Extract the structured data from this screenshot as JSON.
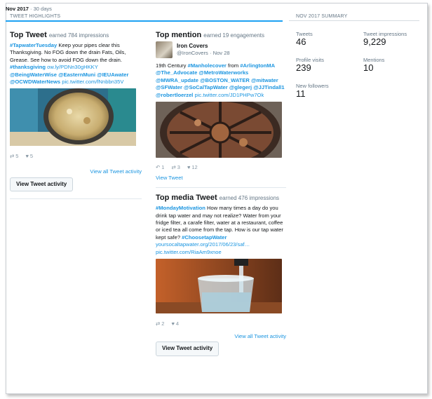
{
  "header": {
    "month": "Nov 2017",
    "sep": "·",
    "days": "30 days"
  },
  "highlights": {
    "title": "TWEET HIGHLIGHTS"
  },
  "top_tweet": {
    "heading": "Top Tweet",
    "metric": "earned 784 impressions",
    "text_parts": [
      {
        "t": "#TapwaterTuesday",
        "k": "hash"
      },
      {
        "t": " Keep your pipes clear this Thanksgiving. No FOG down the drain Fats, Oils, Grease. See how to avoid FOG down the drain. ",
        "k": "plain"
      },
      {
        "t": "#thanksgiving",
        "k": "hash"
      },
      {
        "t": " ow.ly/PDNn30gHKKY ",
        "k": "link"
      },
      {
        "t": "@BeingWaterWise @EasternMuni @IEUAwater @OCWDWaterNews",
        "k": "hash"
      },
      {
        "t": " pic.twitter.com/fNnbbn35V",
        "k": "link"
      }
    ],
    "retweets": "5",
    "likes": "5",
    "view_all": "View all Tweet activity",
    "button": "View Tweet activity"
  },
  "top_mention": {
    "heading": "Top mention",
    "metric": "earned 19 engagements",
    "author_name": "Iron Covers",
    "author_handle": "@IronCovers · Nov 28",
    "text_parts": [
      {
        "t": "19th Century ",
        "k": "plain"
      },
      {
        "t": "#Manholecover",
        "k": "hash"
      },
      {
        "t": " from ",
        "k": "plain"
      },
      {
        "t": "#ArlingtonMA @The_Advocate @MetroWaterworks @MWRA_update @BOSTON_WATER @mitwater @SFWater @SoCalTapWater @glegerj @JJTindall1 @robertloerzel",
        "k": "hash"
      },
      {
        "t": " pic.twitter.com/JD1PHPw7Ok",
        "k": "link"
      }
    ],
    "replies": "1",
    "retweets": "3",
    "likes": "12",
    "view_tweet": "View Tweet"
  },
  "top_media": {
    "heading": "Top media Tweet",
    "metric": "earned 476 impressions",
    "text_parts": [
      {
        "t": "#MondayMotivation",
        "k": "hash"
      },
      {
        "t": " How many times a day do you drink tap water and may not realize? Water from your fridge filter, a carafe filter, water at a restaurant, coffee or iced tea all come from the tap. How is our tap water kept safe? ",
        "k": "plain"
      },
      {
        "t": "#ChoosetapWater",
        "k": "hash"
      },
      {
        "t": " yoursocaltapwater.org/2017/06/23/saf… pic.twitter.com/RiaAm9xnoe",
        "k": "link"
      }
    ],
    "retweets": "2",
    "likes": "4",
    "view_all": "View all Tweet activity",
    "button": "View Tweet activity"
  },
  "summary": {
    "title": "NOV 2017 SUMMARY",
    "items": [
      {
        "label": "Tweets",
        "value": "46"
      },
      {
        "label": "Tweet impressions",
        "value": "9,229"
      },
      {
        "label": "Profile visits",
        "value": "239"
      },
      {
        "label": "Mentions",
        "value": "10"
      },
      {
        "label": "New followers",
        "value": "11"
      }
    ]
  },
  "colors": {
    "accent": "#1da1f2",
    "link": "#1b95e0",
    "muted": "#657786"
  }
}
